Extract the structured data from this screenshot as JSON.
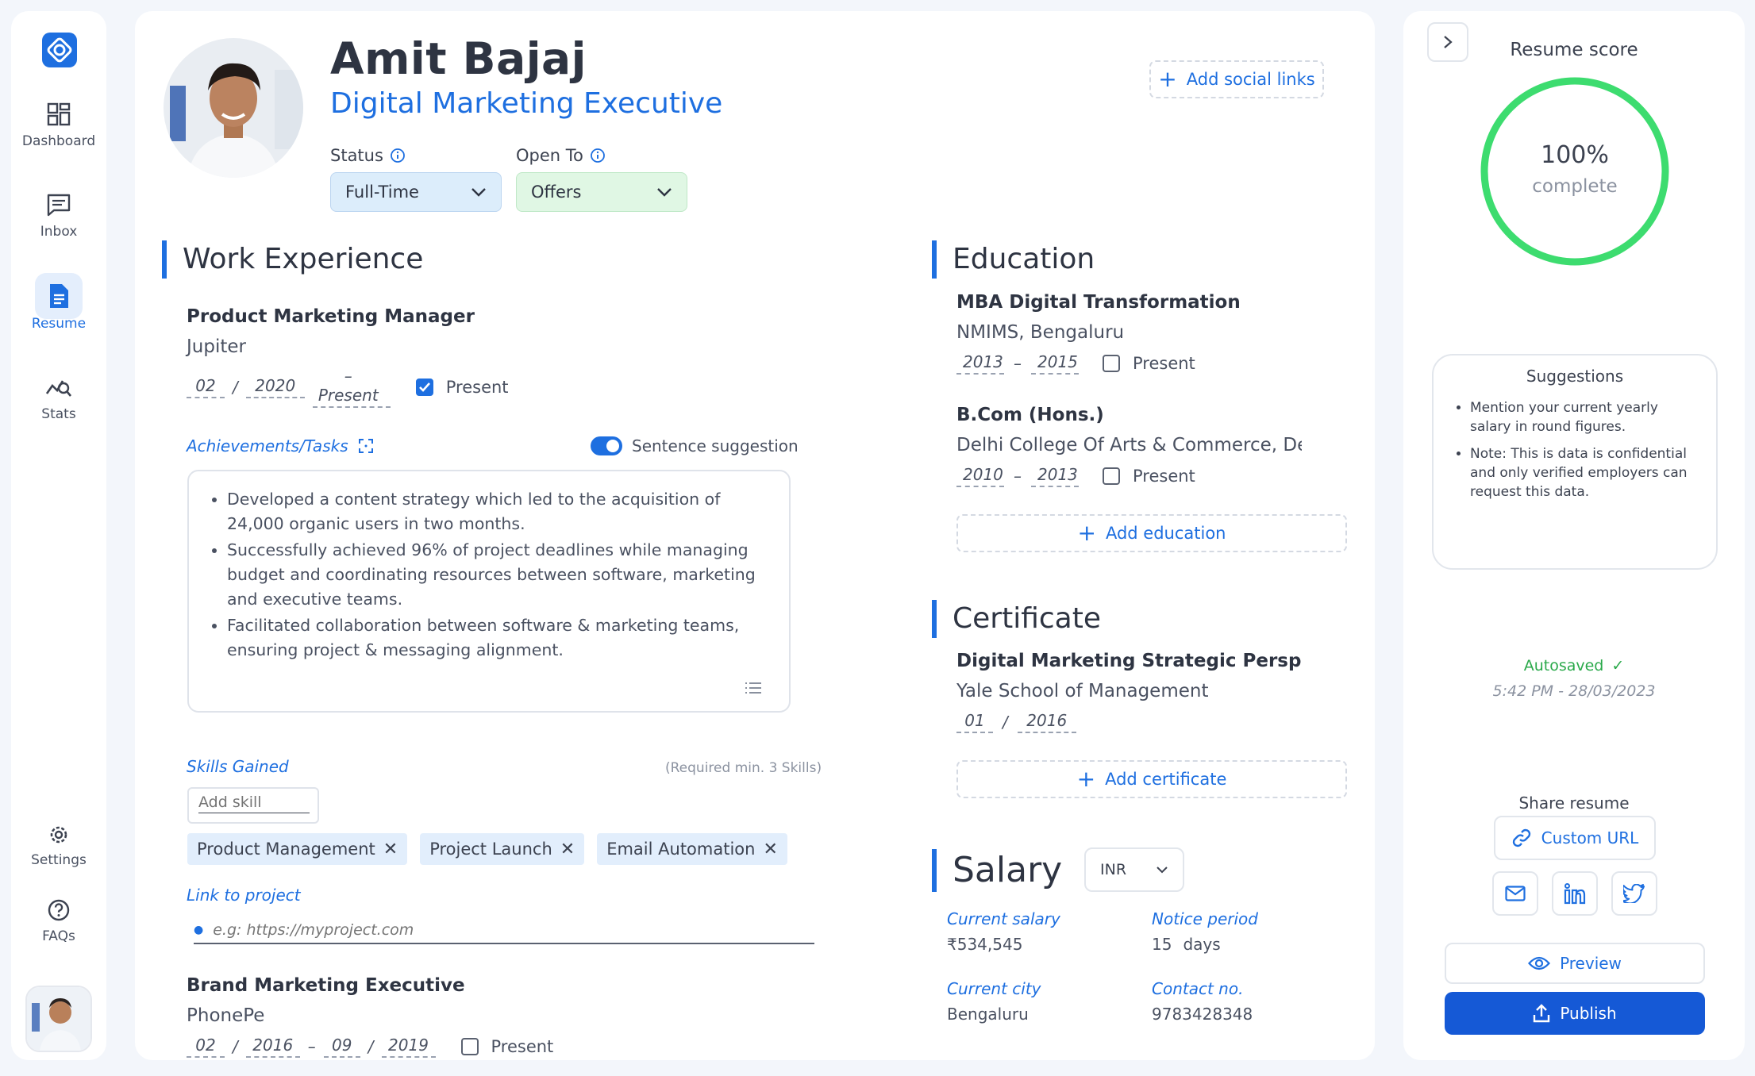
{
  "sidebar": {
    "items": [
      {
        "label": "Dashboard",
        "icon": "dashboard-icon"
      },
      {
        "label": "Inbox",
        "icon": "inbox-icon"
      },
      {
        "label": "Resume",
        "icon": "resume-icon",
        "active": true
      },
      {
        "label": "Stats",
        "icon": "stats-icon"
      }
    ],
    "bottom": [
      {
        "label": "Settings",
        "icon": "gear-icon"
      },
      {
        "label": "FAQs",
        "icon": "help-icon"
      }
    ]
  },
  "profile": {
    "name": "Amit Bajaj",
    "role": "Digital Marketing Executive",
    "add_social": "Add social links",
    "status_label": "Status",
    "status_value": "Full-Time",
    "open_to_label": "Open To",
    "open_to_value": "Offers"
  },
  "work": {
    "title": "Work Experience",
    "jobs": [
      {
        "title": "Product Marketing Manager",
        "company": "Jupiter",
        "start_month": "02",
        "start_year": "2020",
        "end": "Present",
        "present_label": "Present",
        "present": true
      },
      {
        "title": "Brand Marketing Executive",
        "company": "PhonePe",
        "start_month": "02",
        "start_year": "2016",
        "end_month": "09",
        "end_year": "2019",
        "present_label": "Present",
        "present": false
      }
    ],
    "achievements_label": "Achievements/Tasks",
    "sentence_suggestion": "Sentence suggestion",
    "achievements": [
      "Developed a content strategy which led to the acquisition of 24,000 organic users in two months.",
      "Successfully achieved 96% of project deadlines while managing budget and coordinating resources between software, marketing and executive teams.",
      "Facilitated collaboration between software & marketing teams, ensuring project & messaging alignment."
    ],
    "skills_label": "Skills Gained",
    "skills_required": "(Required min. 3 Skills)",
    "skill_placeholder": "Add skill",
    "skills": [
      "Product Management",
      "Project Launch",
      "Email Automation"
    ],
    "link_label": "Link to project",
    "link_placeholder": "e.g: https://myproject.com"
  },
  "education": {
    "title": "Education",
    "items": [
      {
        "degree": "MBA Digital Transformation",
        "school": "NMIMS, Bengaluru",
        "from": "2013",
        "to": "2015",
        "present_label": "Present"
      },
      {
        "degree": "B.Com (Hons.)",
        "school": "Delhi College Of Arts & Commerce, Dell",
        "from": "2010",
        "to": "2013",
        "present_label": "Present"
      }
    ],
    "add_label": "Add education"
  },
  "certificate": {
    "title": "Certificate",
    "name": "Digital Marketing Strategic Perspectiv",
    "issuer": "Yale School of Management",
    "month": "01",
    "year": "2016",
    "add_label": "Add certificate"
  },
  "salary": {
    "title": "Salary",
    "currency": "INR",
    "current_salary_label": "Current salary",
    "current_salary": "₹534,545",
    "notice_label": "Notice period",
    "notice_value": "15",
    "notice_unit": "days",
    "city_label": "Current city",
    "city": "Bengaluru",
    "contact_label": "Contact no.",
    "contact": "9783428348"
  },
  "right": {
    "score_title": "Resume score",
    "score_value": "100%",
    "score_pct": 100,
    "score_sub": "complete",
    "suggestions_title": "Suggestions",
    "suggestions": [
      "Mention your current yearly salary in round figures.",
      "Note: This is data is confidential and only verified employers can request this data."
    ],
    "autosaved": "Autosaved",
    "autosaved_time": "5:42 PM - 28/03/2023",
    "share_title": "Share resume",
    "custom_url": "Custom URL",
    "preview": "Preview",
    "publish": "Publish"
  },
  "colors": {
    "accent": "#1e6fe0",
    "score": "#3ddc6f",
    "autosave": "#2aa94a"
  }
}
